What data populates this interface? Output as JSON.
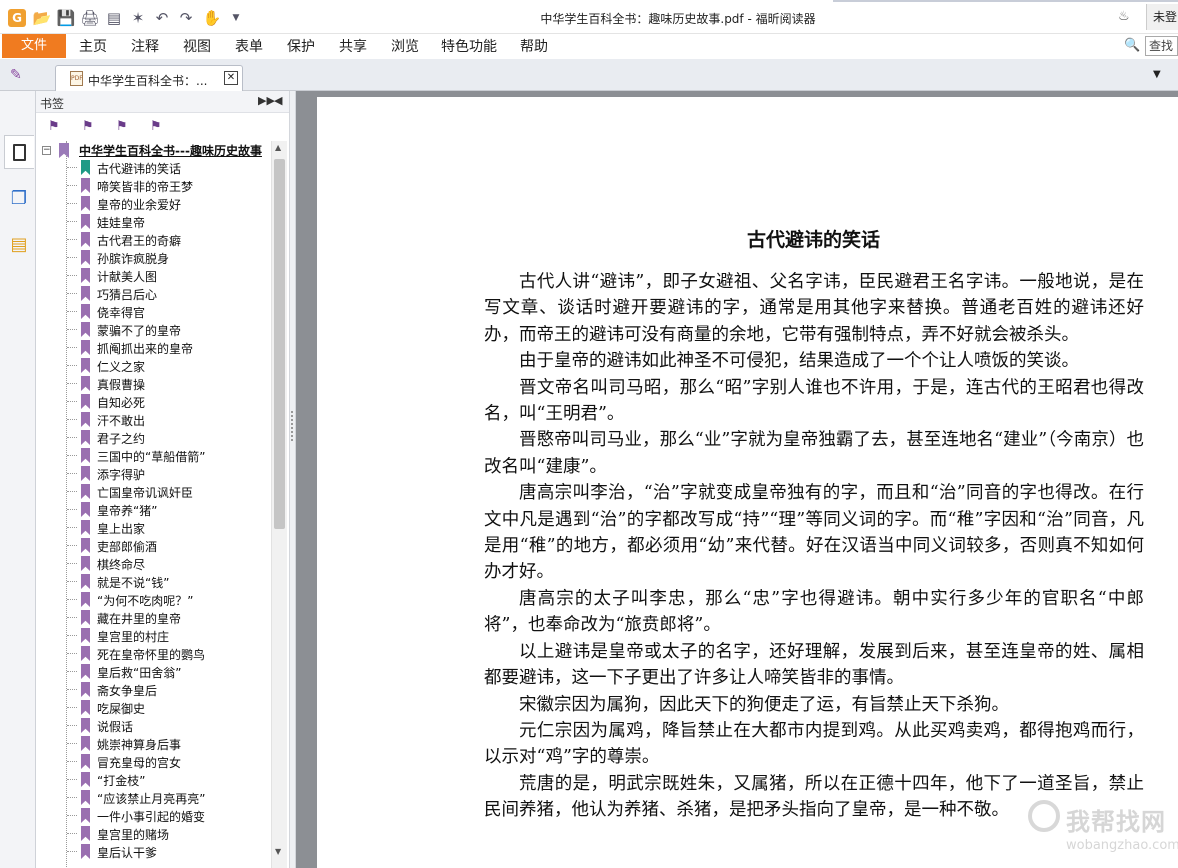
{
  "window": {
    "title": "中华学生百科全书：趣味历史故事.pdf - 福昕阅读器",
    "login_label": "未登"
  },
  "quick_access": [
    "logo-icon",
    "open-icon",
    "save-icon",
    "print-icon",
    "scan-icon",
    "new-icon",
    "undo-icon",
    "redo-icon",
    "hand-tool-icon",
    "dropdown-icon"
  ],
  "menu": {
    "file": "文件",
    "items": [
      "主页",
      "注释",
      "视图",
      "表单",
      "保护",
      "共享",
      "浏览",
      "特色功能",
      "帮助"
    ],
    "search_placeholder": "查找"
  },
  "tab": {
    "title": "中华学生百科全书：...",
    "close": "✕"
  },
  "panel": {
    "title": "书签",
    "tools": [
      "bookmark-delete-icon",
      "bookmark-add-icon",
      "bookmark-goto-icon",
      "bookmark-search-icon"
    ],
    "root": "中华学生百科全书---趣味历史故事",
    "bookmarks": [
      "古代避讳的笑话",
      "啼笑皆非的帝王梦",
      "皇帝的业余爱好",
      "娃娃皇帝",
      "古代君王的奇癖",
      "孙膑诈疯脱身",
      "计献美人图",
      "巧猜吕后心",
      "侥幸得官",
      "蒙骗不了的皇帝",
      "抓阄抓出来的皇帝",
      "仁义之家",
      "真假曹操",
      "自知必死",
      "汗不敢出",
      "君子之约",
      "三国中的“草船借箭”",
      "添字得驴",
      "亡国皇帝讥讽奸臣",
      "皇帝养“猪”",
      "皇上出家",
      "吏部郎偷酒",
      "棋终命尽",
      "就是不说“钱”",
      "“为何不吃肉呢？”",
      "藏在井里的皇帝",
      "皇宫里的村庄",
      "死在皇帝怀里的鹦鸟",
      "皇后救“田舍翁”",
      "斋女争皇后",
      "吃屎御史",
      "说假话",
      "姚崇神算身后事",
      "冒充皇母的宫女",
      "“打金枝”",
      "“应该禁止月亮再亮”",
      "一件小事引起的婚变",
      "皇宫里的赌场",
      "皇后认干爹"
    ]
  },
  "document": {
    "heading": "古代避讳的笑话",
    "paragraphs": [
      "古代人讲“避讳”，即子女避祖、父名字讳，臣民避君王名字讳。一般地说，是在写文章、谈话时避开要避讳的字，通常是用其他字来替换。普通老百姓的避讳还好办，而帝王的避讳可没有商量的余地，它带有强制特点，弄不好就会被杀头。",
      "由于皇帝的避讳如此神圣不可侵犯，结果造成了一个个让人喷饭的笑谈。",
      "晋文帝名叫司马昭，那么“昭”字别人谁也不许用，于是，连古代的王昭君也得改名，叫“王明君”。",
      "晋愍帝叫司马业，那么“业”字就为皇帝独霸了去，甚至连地名“建业”（今南京）也改名叫“建康”。",
      "唐高宗叫李治，“治”字就变成皇帝独有的字，而且和“治”同音的字也得改。在行文中凡是遇到“治”的字都改写成“持”“理”等同义词的字。而“稚”字因和“治”同音，凡是用“稚”的地方，都必须用“幼”来代替。好在汉语当中同义词较多，否则真不知如何办才好。",
      "唐高宗的太子叫李忠，那么“忠”字也得避讳。朝中实行多少年的官职名“中郎将”，也奉命改为“旅贲郎将”。",
      "以上避讳是皇帝或太子的名字，还好理解，发展到后来，甚至连皇帝的姓、属相都要避讳，这一下子更出了许多让人啼笑皆非的事情。",
      "宋徽宗因为属狗，因此天下的狗便走了运，有旨禁止天下杀狗。",
      "元仁宗因为属鸡，降旨禁止在大都市内提到鸡。从此买鸡卖鸡，都得抱鸡而行，以示对“鸡”字的尊崇。",
      "荒唐的是，明武宗既姓朱，又属猪，所以在正德十四年，他下了一道圣旨，禁止民间养猪，他认为养猪、杀猪，是把矛头指向了皇帝，是一种不敬。"
    ]
  },
  "watermark": {
    "text": "我帮找网",
    "sub": "wobangzhao.com"
  },
  "colors": {
    "accent_orange": "#f07b20",
    "bookmark_purple": "#9a6fb0",
    "bookmark_teal": "#1f9a86",
    "doc_background": "#8c8f94"
  }
}
